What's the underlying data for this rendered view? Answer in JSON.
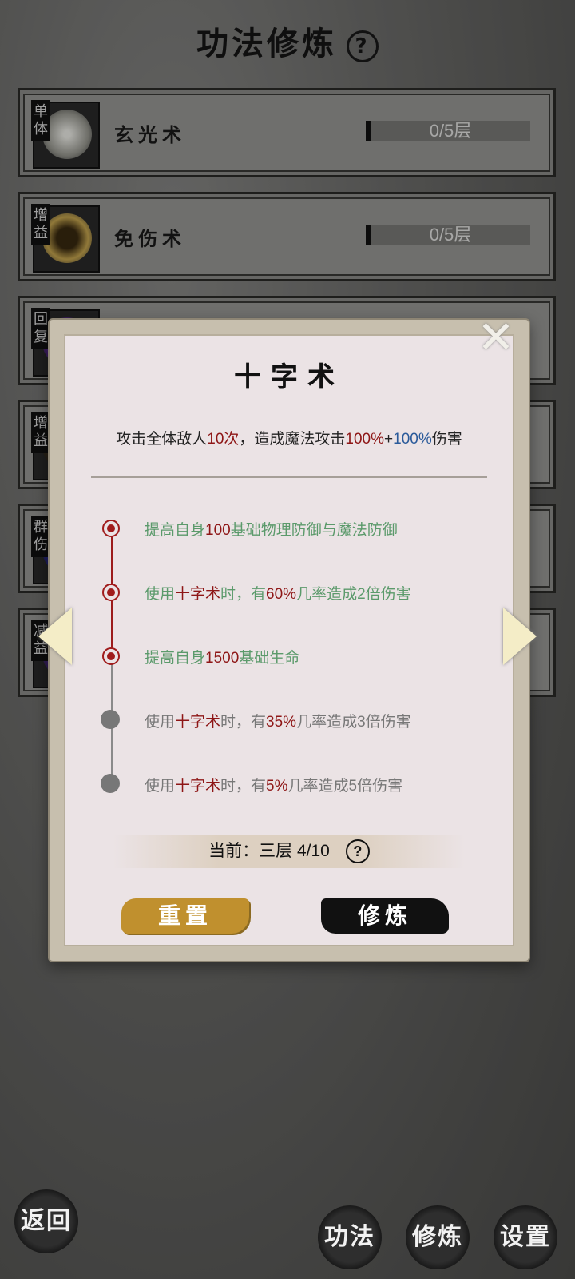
{
  "header": {
    "title": "功法修炼",
    "help": "?"
  },
  "skills": [
    {
      "tag": "单体",
      "name": "玄光术",
      "progress": "0/5层",
      "glow": "#d8d8d0"
    },
    {
      "tag": "增益",
      "name": "免伤术",
      "progress": "0/5层",
      "glow": "#c9a850"
    },
    {
      "tag": "回复",
      "name": "",
      "progress": "",
      "glow": "#7a3ab0"
    },
    {
      "tag": "增益",
      "name": "",
      "progress": "",
      "glow": "#6a5a30"
    },
    {
      "tag": "群伤",
      "name": "",
      "progress": "",
      "glow": "#3a4ac0"
    },
    {
      "tag": "减益",
      "name": "",
      "progress": "",
      "glow": "#6a3ab0"
    }
  ],
  "modal": {
    "title": "十字术",
    "desc": {
      "p1": "攻击全体敌人",
      "count": "10次",
      "p2": "，造成魔法攻击",
      "pct1": "100%",
      "plus": "+",
      "pct2": "100%",
      "p3": "伤害"
    },
    "levels": [
      {
        "active": true,
        "parts": [
          "提高自身",
          "100",
          "基础物理防御与魔法防御"
        ]
      },
      {
        "active": true,
        "parts": [
          "使用",
          "十字术",
          "时，有",
          "60%",
          "几率造成2倍伤害"
        ]
      },
      {
        "active": true,
        "parts": [
          "提高自身",
          "1500",
          "基础生命"
        ]
      },
      {
        "active": false,
        "parts": [
          "使用",
          "十字术",
          "时，有",
          "35%",
          "几率造成3倍伤害"
        ]
      },
      {
        "active": false,
        "parts": [
          "使用",
          "十字术",
          "时，有",
          "5%",
          "几率造成5倍伤害"
        ]
      }
    ],
    "current": "当前：三层 4/10",
    "current_help": "?",
    "reset_label": "重置",
    "cultivate_label": "修炼",
    "close": "✕",
    "prev": "",
    "next": ""
  },
  "bottom": {
    "back": "返回",
    "gongfa": "功法",
    "xiulian": "修炼",
    "settings": "设置"
  },
  "colors": {
    "accent_red": "#8e1616",
    "accent_blue": "#2a5a9a",
    "green": "#5b9a6b",
    "gold": "#c0902e"
  }
}
